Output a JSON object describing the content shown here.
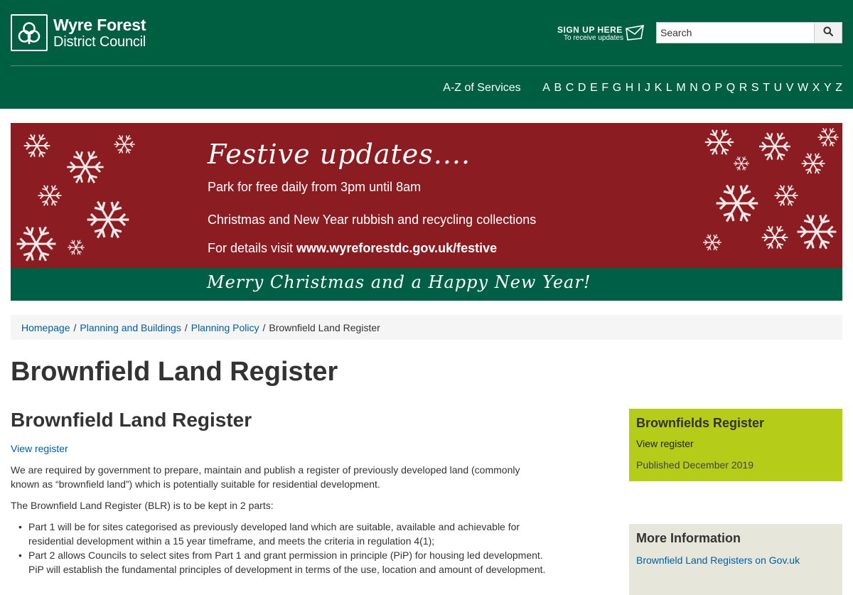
{
  "header": {
    "logo_line1": "Wyre Forest",
    "logo_line2": "District Council",
    "signup_line1": "SIGN UP HERE",
    "signup_line2": "To receive updates",
    "search_placeholder": "Search",
    "search_icon": "search-icon",
    "brand_color": "#005e41"
  },
  "az_nav": {
    "label": "A-Z of Services",
    "letters": [
      "A",
      "B",
      "C",
      "D",
      "E",
      "F",
      "G",
      "H",
      "I",
      "J",
      "K",
      "L",
      "M",
      "N",
      "O",
      "P",
      "Q",
      "R",
      "S",
      "T",
      "U",
      "V",
      "W",
      "X",
      "Y",
      "Z"
    ]
  },
  "banner": {
    "title": "Festive updates....",
    "line1": "Park for free daily from 3pm until 8am",
    "line2": "Christmas and New Year rubbish and recycling collections",
    "line3_prefix": "For details visit ",
    "line3_url": "www.wyreforestdc.gov.uk/festive",
    "greeting": "Merry Christmas and a Happy New Year!",
    "top_color": "#8b1d22",
    "bottom_color": "#006047"
  },
  "breadcrumb": {
    "items": [
      "Homepage",
      "Planning and Buildings",
      "Planning Policy"
    ],
    "current": "Brownfield Land Register",
    "separator": "/"
  },
  "page_title": "Brownfield Land Register",
  "main": {
    "heading": "Brownfield Land Register",
    "view_link": "View register",
    "para1": "We are required by government to prepare, maintain and publish a register of previously developed land (commonly known as “brownfield land”) which is potentially suitable for residential development.",
    "para2": "The Brownfield Land Register (BLR) is to be kept in 2 parts:",
    "list": [
      "Part 1 will be for sites categorised as previously developed land which are suitable, available and achievable for residential development within a 15 year timeframe, and meets the criteria in regulation 4(1);",
      "Part 2 allows Councils to select sites from Part 1 and grant permission in principle (PiP) for housing led development. PiP will establish the fundamental principles of development in terms of the use, location and amount of development."
    ]
  },
  "aside_register": {
    "title": "Brownfields Register",
    "link": "View register",
    "published": "Published December 2019",
    "color": "#b5cc18"
  },
  "aside_more": {
    "title": "More Information",
    "link": "Brownfield Land Registers on Gov.uk",
    "color": "#e6e6da"
  }
}
